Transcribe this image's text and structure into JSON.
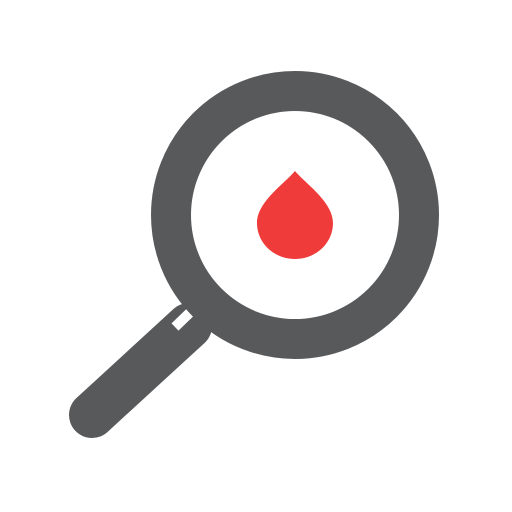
{
  "icon": {
    "name": "magnifier-blood-drop-icon",
    "colors": {
      "background": "#ffffff",
      "magnifier": "#58595b",
      "drop": "#ef3b39"
    },
    "parts": {
      "lens": "magnifier-lens",
      "handle": "magnifier-handle",
      "drop": "blood-drop-icon"
    }
  }
}
